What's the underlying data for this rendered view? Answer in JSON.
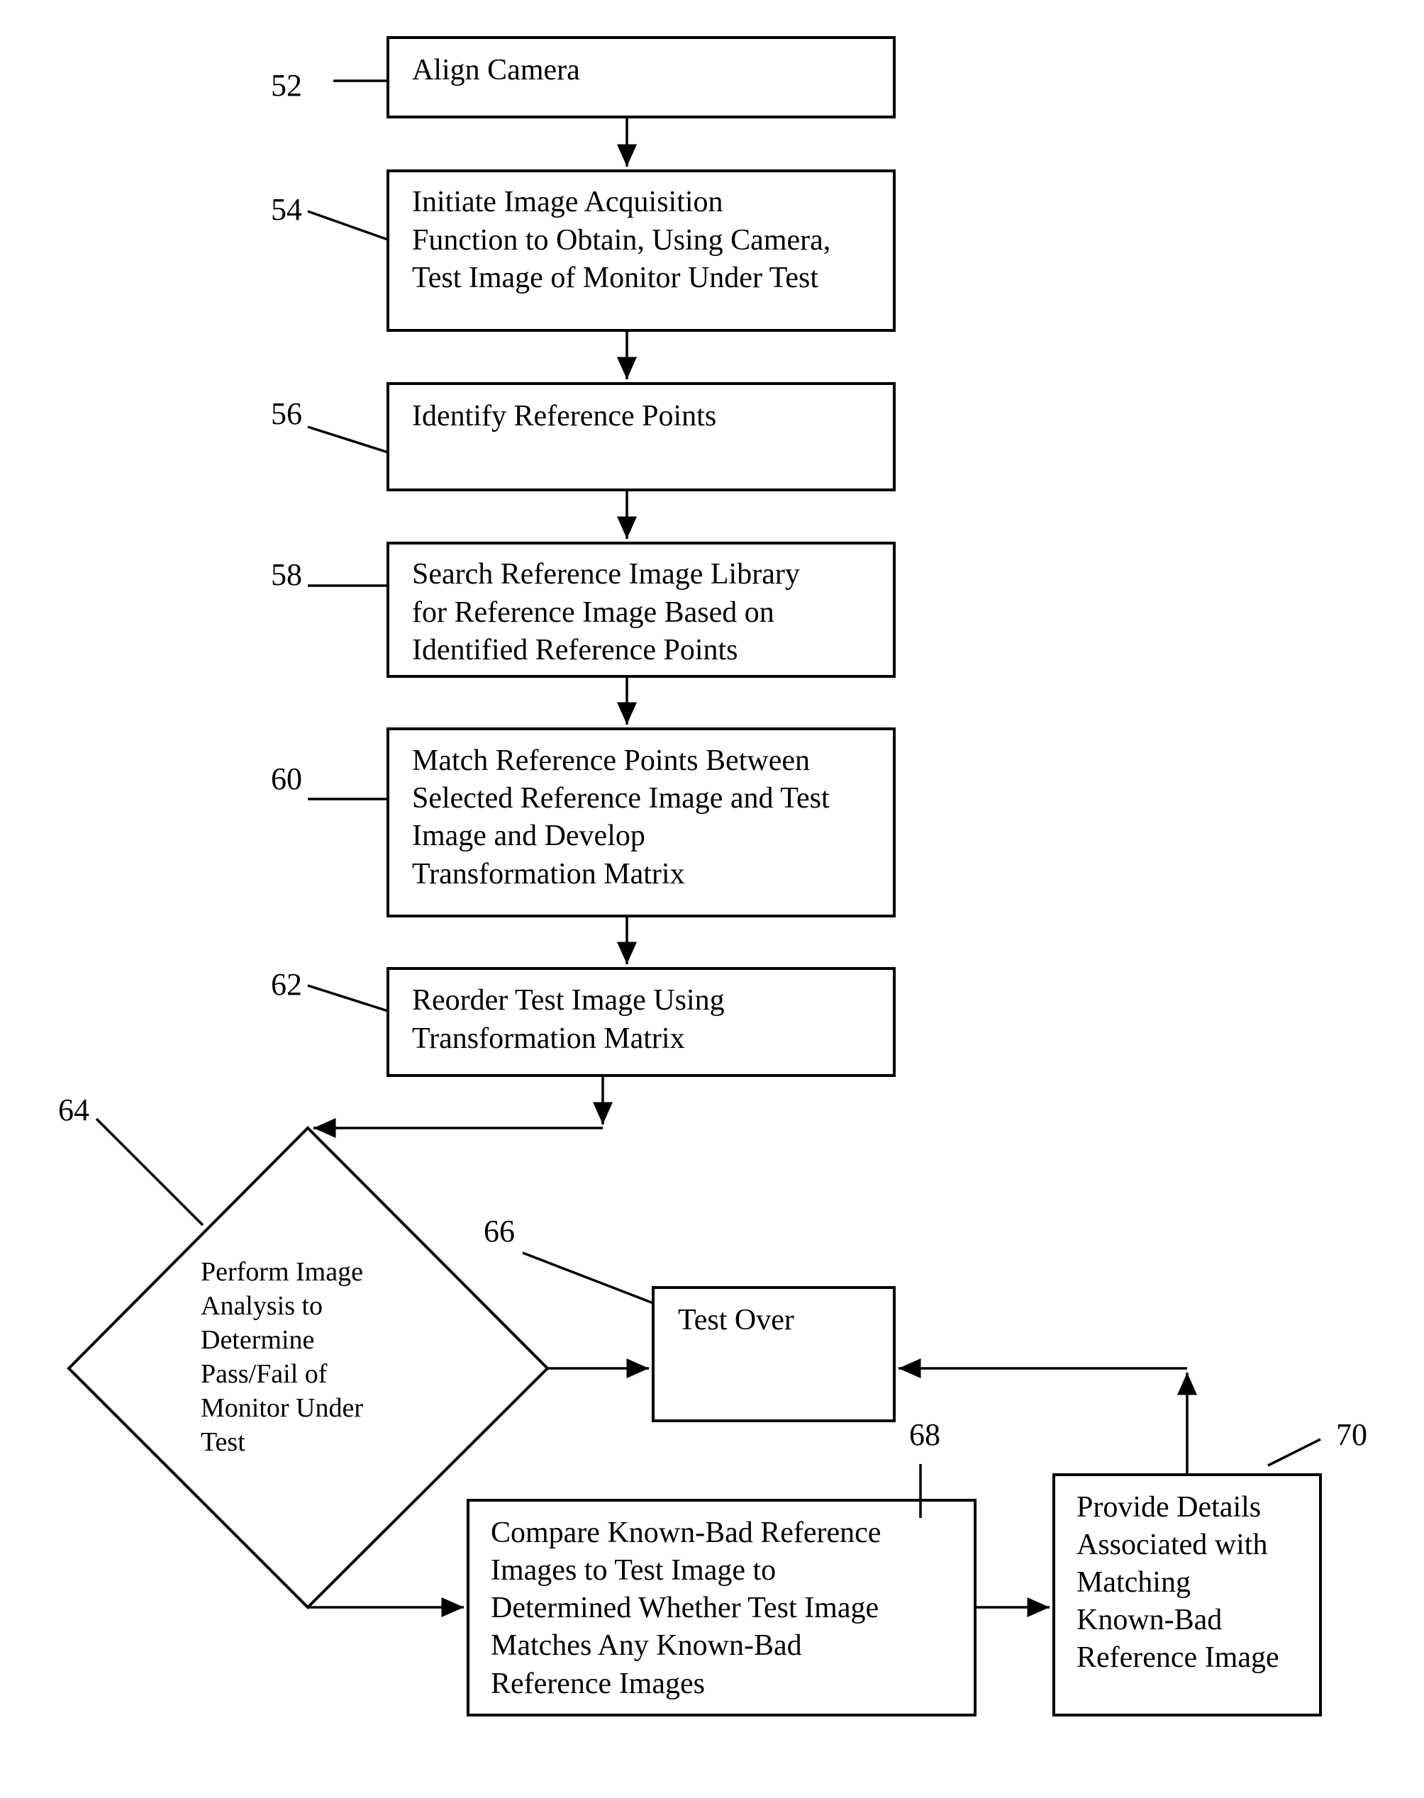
{
  "steps": {
    "s52": {
      "ref": "52",
      "lines": [
        "Align Camera"
      ]
    },
    "s54": {
      "ref": "54",
      "lines": [
        "Initiate Image Acquisition",
        "Function to Obtain, Using Camera,",
        "Test Image of Monitor Under Test"
      ]
    },
    "s56": {
      "ref": "56",
      "lines": [
        "Identify Reference Points"
      ]
    },
    "s58": {
      "ref": "58",
      "lines": [
        "Search Reference Image Library",
        "for Reference Image Based on",
        "Identified Reference Points"
      ]
    },
    "s60": {
      "ref": "60",
      "lines": [
        "Match Reference Points Between",
        "Selected Reference Image and Test",
        "Image and Develop",
        "Transformation Matrix"
      ]
    },
    "s62": {
      "ref": "62",
      "lines": [
        "Reorder Test Image Using",
        "Transformation Matrix"
      ]
    },
    "s64": {
      "ref": "64",
      "lines": [
        "Perform Image",
        "Analysis to",
        "Determine",
        "Pass/Fail of",
        "Monitor Under",
        "Test"
      ]
    },
    "s66": {
      "ref": "66",
      "lines": [
        "Test Over"
      ]
    },
    "s68": {
      "ref": "68",
      "lines": [
        "Compare Known-Bad Reference",
        "Images to Test Image to",
        "Determined Whether Test Image",
        "Matches Any Known-Bad",
        "Reference Images"
      ]
    },
    "s70": {
      "ref": "70",
      "lines": [
        "Provide Details",
        "Associated with",
        "Matching",
        "Known-Bad",
        "Reference Image"
      ]
    }
  }
}
